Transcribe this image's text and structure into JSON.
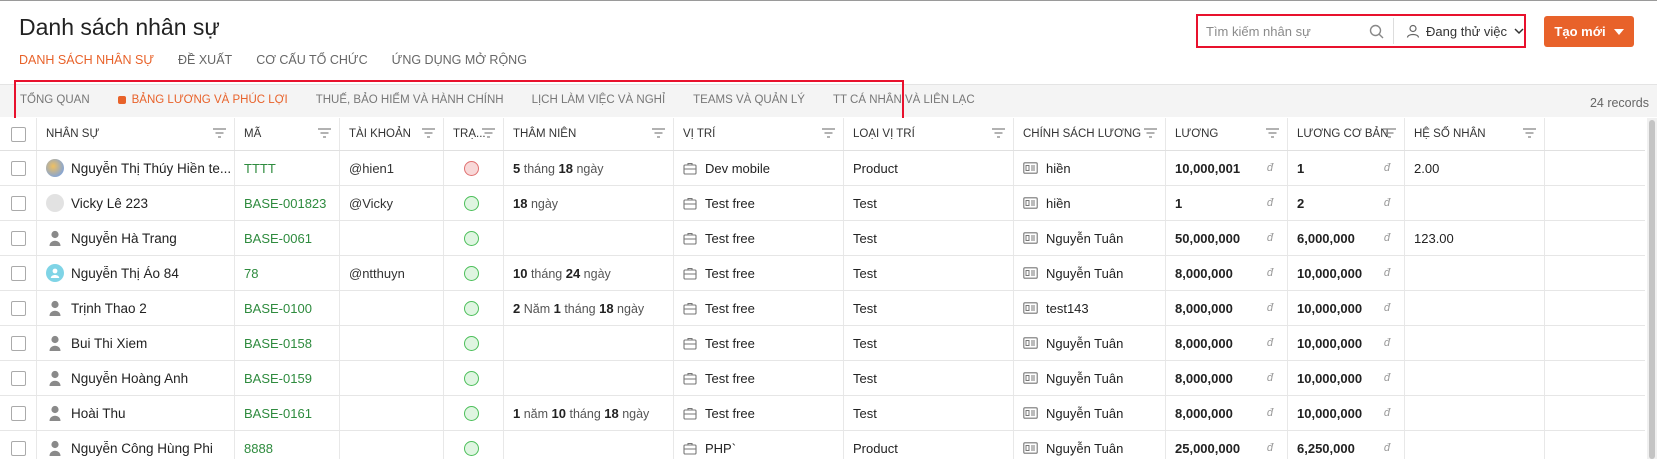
{
  "page": {
    "title": "Danh sách nhân sự"
  },
  "main_tabs": [
    {
      "label": "DANH SÁCH NHÂN SỰ",
      "active": true
    },
    {
      "label": "ĐỀ XUẤT",
      "active": false
    },
    {
      "label": "CƠ CẤU TỔ CHỨC",
      "active": false
    },
    {
      "label": "ỨNG DỤNG MỞ RỘNG",
      "active": false
    }
  ],
  "search": {
    "placeholder": "Tìm kiếm nhân sự",
    "value": ""
  },
  "status_filter": {
    "label": "Đang thử việc"
  },
  "create_button": {
    "label": "Tạo mới"
  },
  "sub_tabs": [
    {
      "label": "TỔNG QUAN"
    },
    {
      "label": "BẢNG LƯƠNG VÀ PHÚC LỢI"
    },
    {
      "label": "THUẾ, BẢO HIỂM VÀ HÀNH CHÍNH"
    },
    {
      "label": "LỊCH LÀM VIỆC VÀ NGHỈ"
    },
    {
      "label": "TEAMS VÀ QUẢN LÝ"
    },
    {
      "label": "TT CÁ NHÂN VÀ LIÊN LẠC"
    }
  ],
  "records_label": "24 records",
  "columns": {
    "name": "NHÂN SỰ",
    "code": "MÃ",
    "account": "TÀI KHOẢN",
    "status": "TRẠ...",
    "seniority": "THÂM NIÊN",
    "position": "VỊ TRÍ",
    "position_type": "LOẠI VỊ TRÍ",
    "salary_policy": "CHÍNH SÁCH LƯƠNG",
    "salary": "LƯƠNG",
    "base_salary": "LƯƠNG CƠ BẢN",
    "coefficient": "HỆ SỐ NHÂN"
  },
  "currency_symbol": "đ",
  "rows": [
    {
      "avatar": "photo",
      "name": "Nguyễn Thị Thúy Hiền te...",
      "code": "TTTT",
      "account": "@hien1",
      "status": "red",
      "seniority": [
        {
          "n": "5",
          "u": "tháng"
        },
        {
          "n": "18",
          "u": "ngày"
        }
      ],
      "position": "Dev mobile",
      "position_type": "Product",
      "salary_policy": "hiền",
      "salary": "10,000,001",
      "base_salary": "1",
      "coefficient": "2.00"
    },
    {
      "avatar": "blank",
      "name": "Vicky Lê 223",
      "code": "BASE-001823",
      "account": "@Vicky",
      "status": "green",
      "seniority": [
        {
          "n": "18",
          "u": "ngày"
        }
      ],
      "position": "Test free",
      "position_type": "Test",
      "salary_policy": "hiền",
      "salary": "1",
      "base_salary": "2",
      "coefficient": ""
    },
    {
      "avatar": "person",
      "name": "Nguyễn Hà Trang",
      "code": "BASE-0061",
      "account": "",
      "status": "green",
      "seniority": [],
      "position": "Test free",
      "position_type": "Test",
      "salary_policy": "Nguyễn Tuân",
      "salary": "50,000,000",
      "base_salary": "6,000,000",
      "coefficient": "123.00"
    },
    {
      "avatar": "teal",
      "name": "Nguyễn Thị Áo 84",
      "code": "78",
      "account": "@ntthuyn",
      "status": "green",
      "seniority": [
        {
          "n": "10",
          "u": "tháng"
        },
        {
          "n": "24",
          "u": "ngày"
        }
      ],
      "position": "Test free",
      "position_type": "Test",
      "salary_policy": "Nguyễn Tuân",
      "salary": "8,000,000",
      "base_salary": "10,000,000",
      "coefficient": ""
    },
    {
      "avatar": "person",
      "name": "Trịnh Thao 2",
      "code": "BASE-0100",
      "account": "",
      "status": "green",
      "seniority": [
        {
          "n": "2",
          "u": "Năm"
        },
        {
          "n": "1",
          "u": "tháng"
        },
        {
          "n": "18",
          "u": "ngày"
        }
      ],
      "position": "Test free",
      "position_type": "Test",
      "salary_policy": "test143",
      "salary": "8,000,000",
      "base_salary": "10,000,000",
      "coefficient": ""
    },
    {
      "avatar": "person",
      "name": "Bui Thi Xiem",
      "code": "BASE-0158",
      "account": "",
      "status": "green",
      "seniority": [],
      "position": "Test free",
      "position_type": "Test",
      "salary_policy": "Nguyễn Tuân",
      "salary": "8,000,000",
      "base_salary": "10,000,000",
      "coefficient": ""
    },
    {
      "avatar": "person",
      "name": "Nguyễn Hoàng Anh",
      "code": "BASE-0159",
      "account": "",
      "status": "green",
      "seniority": [],
      "position": "Test free",
      "position_type": "Test",
      "salary_policy": "Nguyễn Tuân",
      "salary": "8,000,000",
      "base_salary": "10,000,000",
      "coefficient": ""
    },
    {
      "avatar": "person",
      "name": "Hoài Thu",
      "code": "BASE-0161",
      "account": "",
      "status": "green",
      "seniority": [
        {
          "n": "1",
          "u": "năm"
        },
        {
          "n": "10",
          "u": "tháng"
        },
        {
          "n": "18",
          "u": "ngày"
        }
      ],
      "position": "Test free",
      "position_type": "Test",
      "salary_policy": "Nguyễn Tuân",
      "salary": "8,000,000",
      "base_salary": "10,000,000",
      "coefficient": ""
    },
    {
      "avatar": "person",
      "name": "Nguyễn Công Hùng Phi",
      "code": "8888",
      "account": "",
      "status": "green",
      "seniority": [],
      "position": "PHP`",
      "position_type": "Product",
      "salary_policy": "Nguyễn Tuân",
      "salary": "25,000,000",
      "base_salary": "6,250,000",
      "coefficient": ""
    }
  ]
}
